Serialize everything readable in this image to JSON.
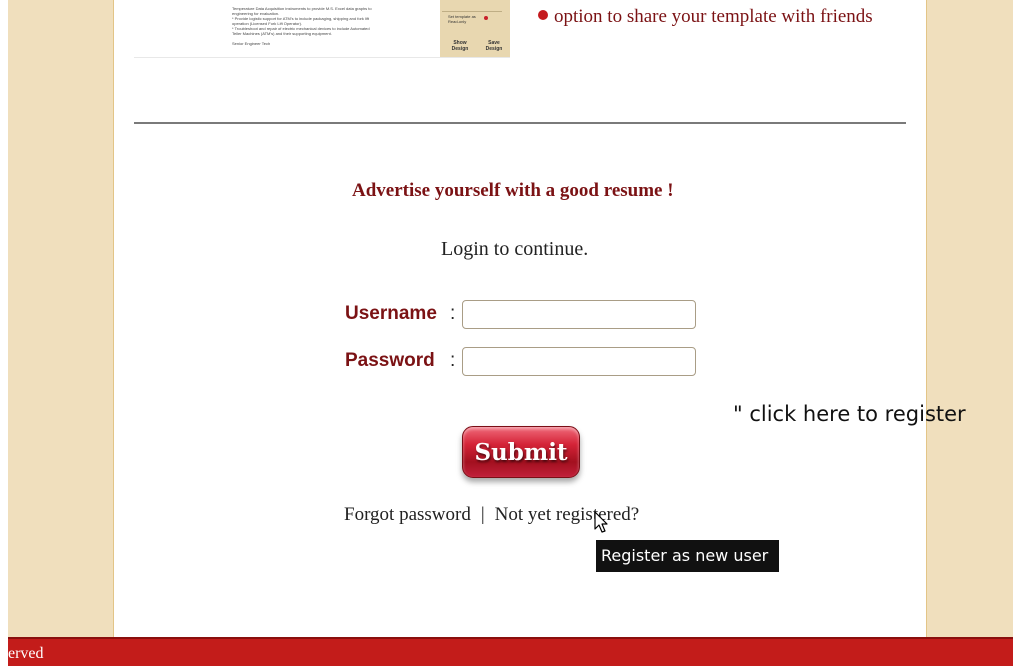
{
  "preview": {
    "text_lines": [
      "Temperature Data Acquisition instruments to provide M.S. Excel data graphs to",
      "engineering for evaluation.",
      "  * Provide logistic support for ATM's to include packaging, shipping and fork lift",
      "operation (Licensed Fork Lift Operator).",
      "  * Troubleshoot and repair of electric mechanical devices to include Automated",
      "Teller Machines (ATM's) and their supporting equipment.",
      "",
      "Senior Engineer Tech"
    ],
    "option_label": "Set template as Read-only",
    "show_design": "Show Design",
    "save_design": "Save Design"
  },
  "feature_text": "option to share your template with friends",
  "headline": "Advertise yourself with a good resume !",
  "login_prompt": "Login to continue.",
  "form": {
    "username_label": "Username",
    "password_label": "Password",
    "colon": ":",
    "username_value": "",
    "password_value": ""
  },
  "click_register_text": "\" click here to register",
  "submit_label": "Submit",
  "links": {
    "forgot": "Forgot password",
    "separator": "|",
    "register": "Not yet registered?"
  },
  "tooltip": "Register as new user",
  "footer_text": "erved",
  "colors": {
    "brand_red": "#c31c1a",
    "label_maroon": "#7b1214",
    "side_beige": "#f0dfbd"
  }
}
